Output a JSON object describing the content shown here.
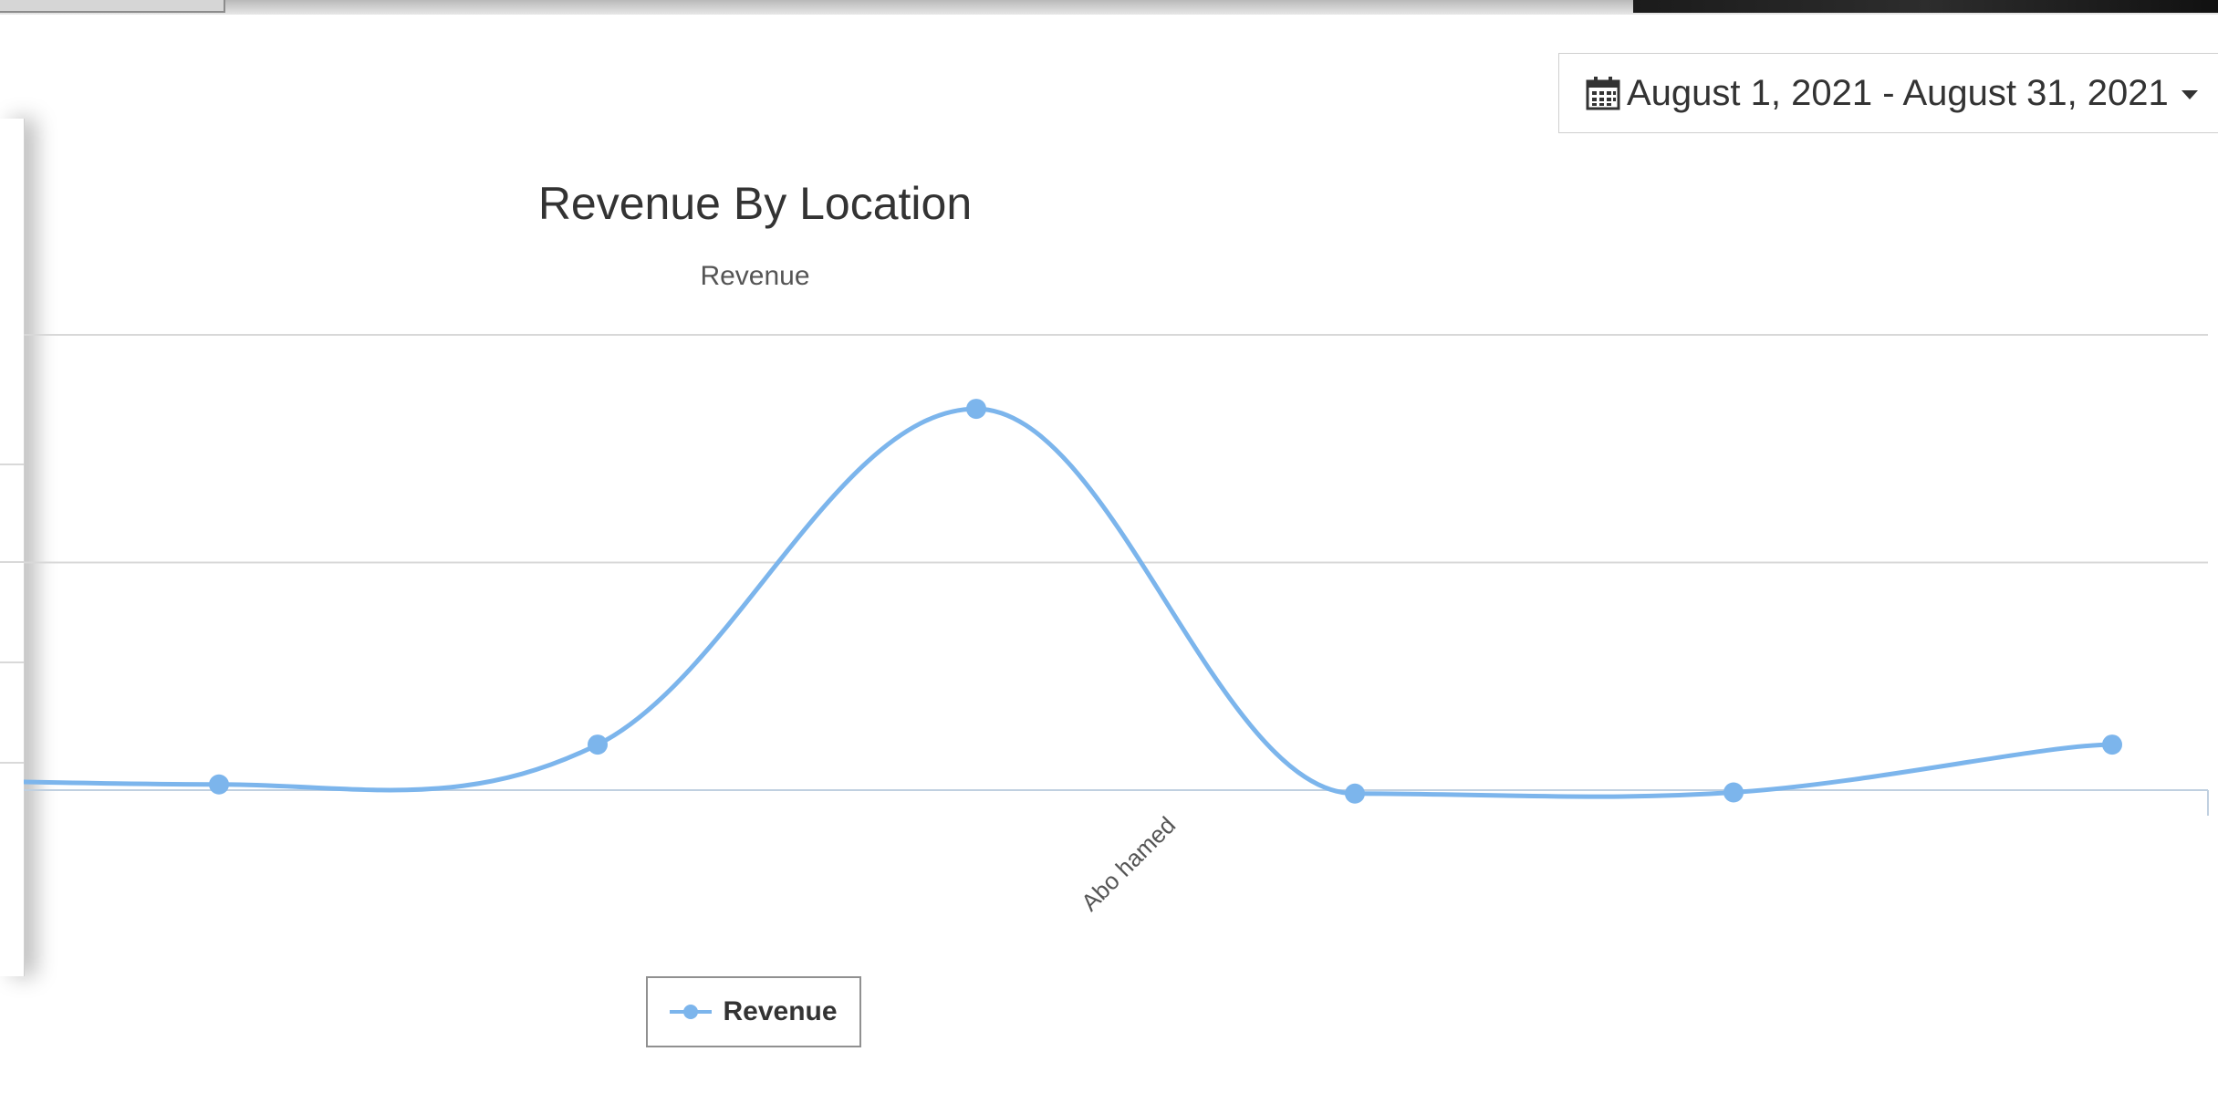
{
  "date_range": {
    "label": "August 1, 2021 - August 31, 2021",
    "icon": "calendar-icon"
  },
  "chart_data": {
    "type": "line",
    "title": "Revenue By Location",
    "subtitle": "Revenue",
    "categories": [
      "",
      "",
      "Abo hamed",
      "",
      "",
      ""
    ],
    "series": [
      {
        "name": "Revenue",
        "color": "#7cb5ec",
        "values": [
          5,
          40,
          335,
          -3,
          -2,
          40
        ]
      }
    ],
    "ylim": [
      0,
      400
    ],
    "grid": true,
    "smooth": true,
    "legend": "bottom-left"
  }
}
